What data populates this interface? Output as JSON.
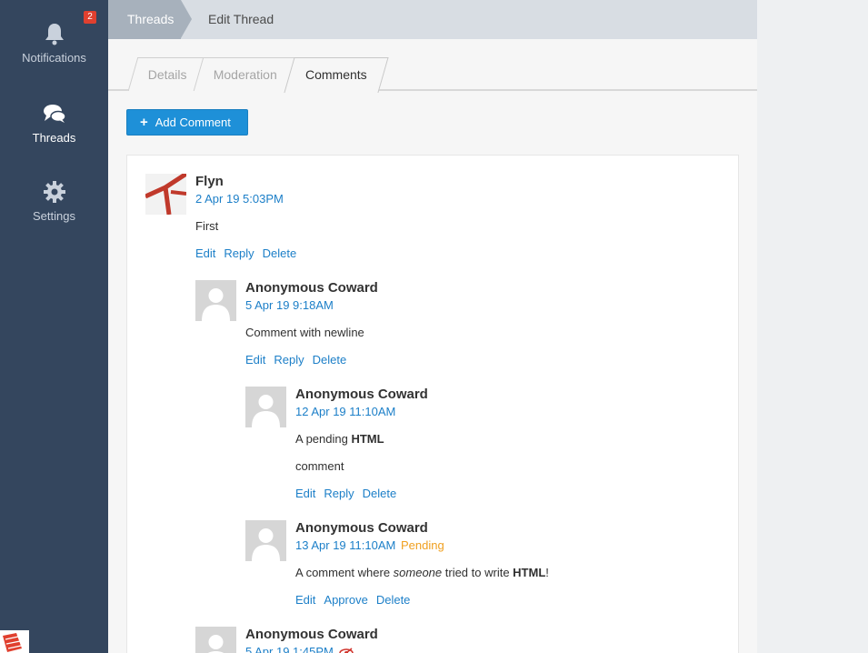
{
  "sidebar": {
    "items": [
      {
        "label": "Notifications",
        "icon": "bell-icon",
        "badge": "2"
      },
      {
        "label": "Threads",
        "icon": "comments-icon"
      },
      {
        "label": "Settings",
        "icon": "gear-icon"
      }
    ]
  },
  "breadcrumb": {
    "first": "Threads",
    "second": "Edit Thread"
  },
  "tabs": [
    "Details",
    "Moderation",
    "Comments"
  ],
  "add_comment_label": "Add Comment",
  "colors": {
    "sidebar": "#34465e",
    "accent": "#1e90d8",
    "link": "#1c7fc8",
    "pending": "#f0a020",
    "badge": "#e0402f"
  },
  "comments": [
    {
      "author": "Flyn",
      "timestamp": "2 Apr 19 5:03PM",
      "body": "First",
      "actions": [
        "Edit",
        "Reply",
        "Delete"
      ]
    },
    {
      "author": "Anonymous Coward",
      "timestamp": "5 Apr 19 9:18AM",
      "body": "Comment with newline",
      "actions": [
        "Edit",
        "Reply",
        "Delete"
      ]
    },
    {
      "author": "Anonymous Coward",
      "timestamp": "12 Apr 19 11:10AM",
      "body_line1_prefix": "A pending ",
      "body_line1_bold": "HTML",
      "body_line2": "comment",
      "actions": [
        "Edit",
        "Reply",
        "Delete"
      ]
    },
    {
      "author": "Anonymous Coward",
      "timestamp": "13 Apr 19 11:10AM",
      "status": "Pending",
      "body_prefix": "A comment where ",
      "body_italic": "someone",
      "body_middle": " tried to write ",
      "body_bold": "HTML",
      "body_suffix": "!",
      "actions": [
        "Edit",
        "Approve",
        "Delete"
      ]
    },
    {
      "author": "Anonymous Coward",
      "timestamp": "5 Apr 19 1:45PM"
    }
  ]
}
